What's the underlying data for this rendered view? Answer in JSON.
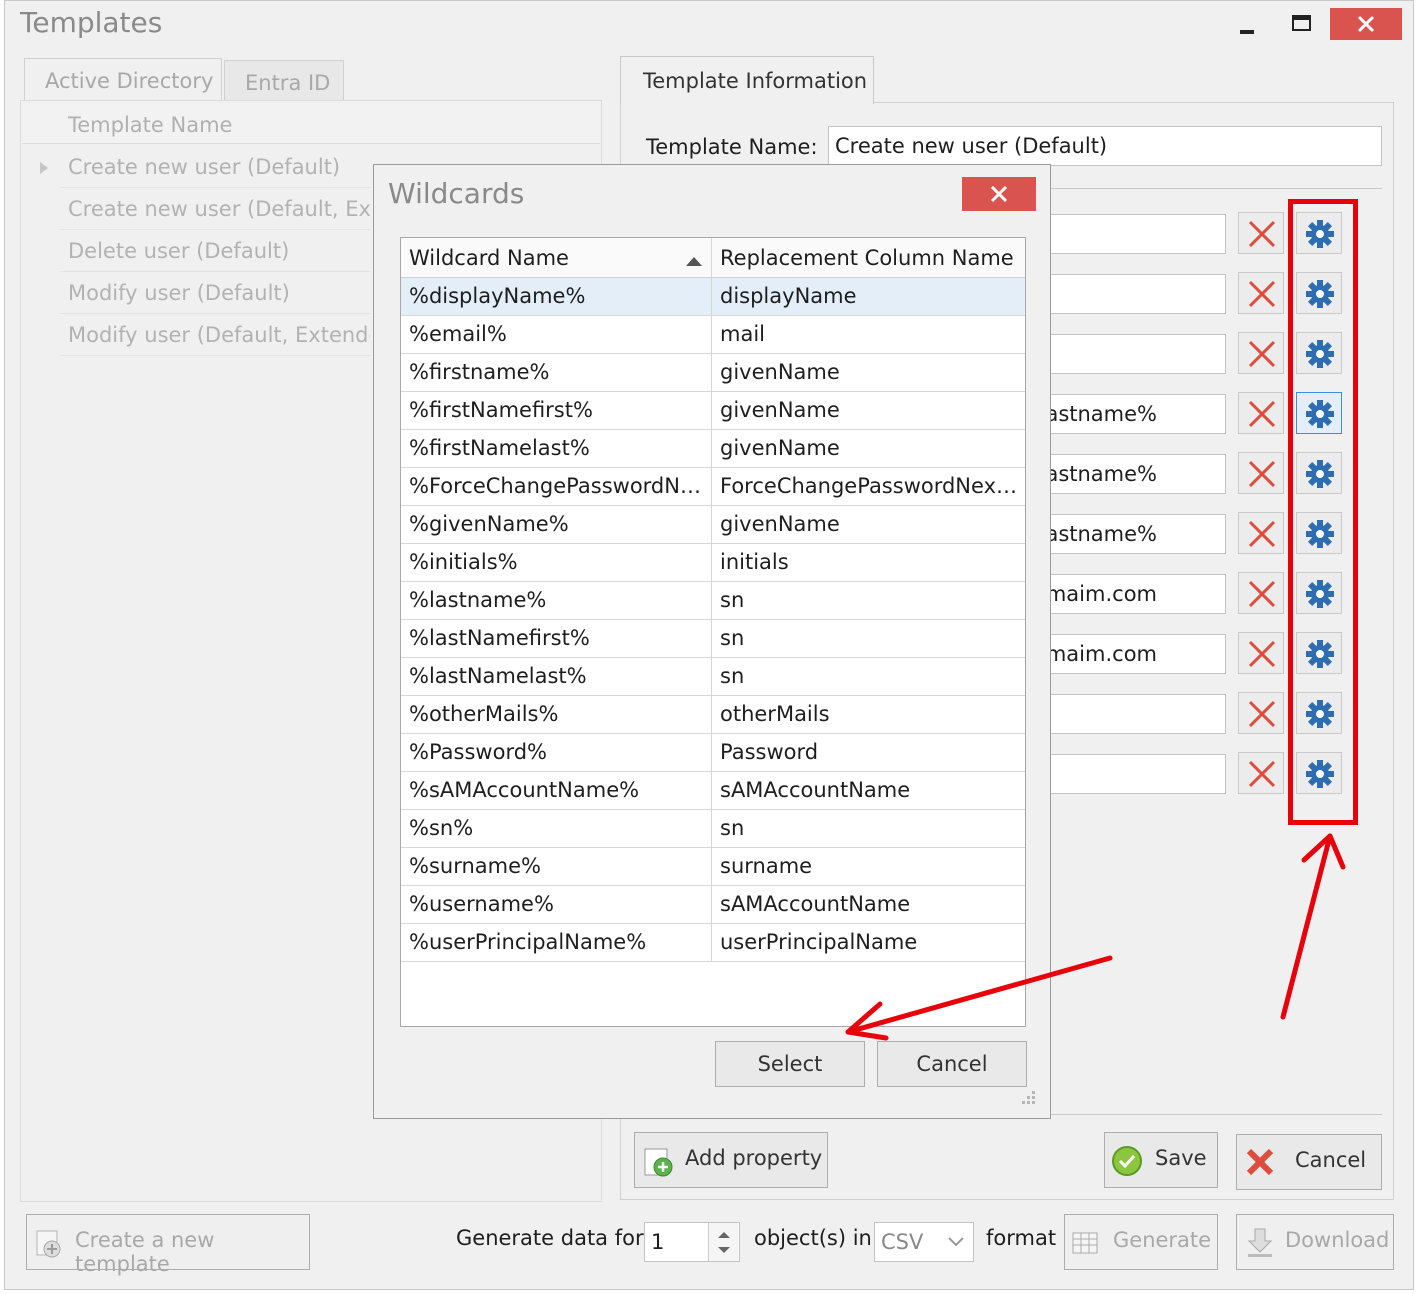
{
  "window": {
    "title": "Templates",
    "minimize_icon": "minimize-icon",
    "maximize_icon": "maximize-icon",
    "close_icon": "close-icon",
    "close_color": "#d9534f"
  },
  "left": {
    "tabs": [
      "Active Directory",
      "Entra ID"
    ],
    "column_header": "Template Name",
    "templates": [
      "Create new user (Default)",
      "Create new user (Default, Extended)",
      "Delete user (Default)",
      "Modify user (Default)",
      "Modify user (Default, Extended)"
    ]
  },
  "right": {
    "tab": "Template Information",
    "template_name_label": "Template Name:",
    "template_name_value": "Create new user (Default)",
    "property_values": [
      "",
      "",
      "",
      "lastname%",
      "lastname%",
      "lastname%",
      "domaim.com",
      "domaim.com",
      "",
      ""
    ],
    "add_property": "Add property",
    "save": "Save",
    "cancel": "Cancel"
  },
  "bottom": {
    "create_template": "Create a new template",
    "generate_for": "Generate data for",
    "count": "1",
    "objects_in": "object(s) in",
    "format": "CSV",
    "format_suffix": "format",
    "generate": "Generate",
    "download": "Download"
  },
  "dialog": {
    "title": "Wildcards",
    "col1": "Wildcard Name",
    "col2": "Replacement Column Name",
    "sort_icon": "sort-ascending-icon",
    "rows": [
      {
        "name": "%displayName%",
        "col": "displayName"
      },
      {
        "name": "%email%",
        "col": "mail"
      },
      {
        "name": "%firstname%",
        "col": "givenName"
      },
      {
        "name": "%firstNamefirst%",
        "col": "givenName"
      },
      {
        "name": "%firstNamelast%",
        "col": "givenName"
      },
      {
        "name": "%ForceChangePasswordNe...",
        "col": "ForceChangePasswordNextS..."
      },
      {
        "name": "%givenName%",
        "col": "givenName"
      },
      {
        "name": "%initials%",
        "col": "initials"
      },
      {
        "name": "%lastname%",
        "col": "sn"
      },
      {
        "name": "%lastNamefirst%",
        "col": "sn"
      },
      {
        "name": "%lastNamelast%",
        "col": "sn"
      },
      {
        "name": "%otherMails%",
        "col": "otherMails"
      },
      {
        "name": "%Password%",
        "col": "Password"
      },
      {
        "name": "%sAMAccountName%",
        "col": "sAMAccountName"
      },
      {
        "name": "%sn%",
        "col": "sn"
      },
      {
        "name": "%surname%",
        "col": "surname"
      },
      {
        "name": "%username%",
        "col": "sAMAccountName"
      },
      {
        "name": "%userPrincipalName%",
        "col": "userPrincipalName"
      }
    ],
    "select": "Select",
    "cancel": "Cancel"
  },
  "annotation_color": "#e8000b"
}
